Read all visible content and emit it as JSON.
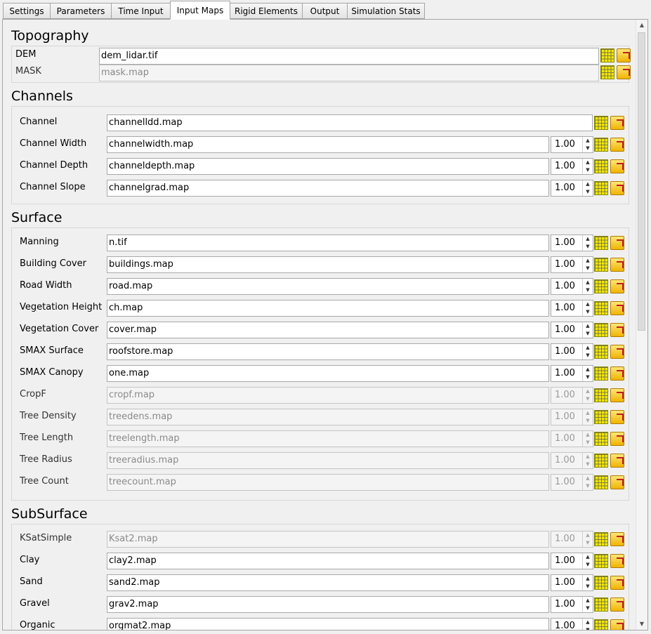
{
  "tabs": [
    "Settings",
    "Parameters",
    "Time Input",
    "Input Maps",
    "Rigid Elements",
    "Output",
    "Simulation Stats"
  ],
  "active_tab": "Input Maps",
  "sections": {
    "topography": {
      "title": "Topography",
      "rows": [
        {
          "label": "DEM",
          "value": "dem_lidar.tif",
          "enabled": true
        },
        {
          "label": "MASK",
          "value": "mask.map",
          "enabled": false
        }
      ]
    },
    "channels": {
      "title": "Channels",
      "rows": [
        {
          "label": "Channel",
          "value": "channelldd.map",
          "enabled": true,
          "factor": null
        },
        {
          "label": "Channel Width",
          "value": "channelwidth.map",
          "enabled": true,
          "factor": "1.00"
        },
        {
          "label": "Channel Depth",
          "value": "channeldepth.map",
          "enabled": true,
          "factor": "1.00"
        },
        {
          "label": "Channel Slope",
          "value": "channelgrad.map",
          "enabled": true,
          "factor": "1.00"
        }
      ]
    },
    "surface": {
      "title": "Surface",
      "rows": [
        {
          "label": "Manning",
          "value": "n.tif",
          "enabled": true,
          "factor": "1.00"
        },
        {
          "label": "Building Cover",
          "value": "buildings.map",
          "enabled": true,
          "factor": "1.00"
        },
        {
          "label": "Road Width",
          "value": "road.map",
          "enabled": true,
          "factor": "1.00"
        },
        {
          "label": "Vegetation Height",
          "value": "ch.map",
          "enabled": true,
          "factor": "1.00"
        },
        {
          "label": "Vegetation Cover",
          "value": "cover.map",
          "enabled": true,
          "factor": "1.00"
        },
        {
          "label": "SMAX Surface",
          "value": "roofstore.map",
          "enabled": true,
          "factor": "1.00"
        },
        {
          "label": "SMAX Canopy",
          "value": "one.map",
          "enabled": true,
          "factor": "1.00"
        },
        {
          "label": "CropF",
          "value": "cropf.map",
          "enabled": false,
          "factor": "1.00"
        },
        {
          "label": "Tree Density",
          "value": "treedens.map",
          "enabled": false,
          "factor": "1.00"
        },
        {
          "label": "Tree Length",
          "value": "treelength.map",
          "enabled": false,
          "factor": "1.00"
        },
        {
          "label": "Tree Radius",
          "value": "treeradius.map",
          "enabled": false,
          "factor": "1.00"
        },
        {
          "label": "Tree Count",
          "value": "treecount.map",
          "enabled": false,
          "factor": "1.00"
        }
      ]
    },
    "subsurface": {
      "title": "SubSurface",
      "rows": [
        {
          "label": "KSatSimple",
          "value": "Ksat2.map",
          "enabled": false,
          "factor": "1.00"
        },
        {
          "label": "Clay",
          "value": "clay2.map",
          "enabled": true,
          "factor": "1.00"
        },
        {
          "label": "Sand",
          "value": "sand2.map",
          "enabled": true,
          "factor": "1.00"
        },
        {
          "label": "Gravel",
          "value": "grav2.map",
          "enabled": true,
          "factor": "1.00"
        },
        {
          "label": "Organic",
          "value": "orgmat2.map",
          "enabled": true,
          "factor": "1.00"
        }
      ]
    }
  },
  "icons": {
    "map_view": "grid-map-icon",
    "browse": "open-folder-icon"
  },
  "colors": {
    "map_icon": "#f4e800",
    "folder_icon": "#f0b400",
    "arrow": "#c0201c"
  }
}
